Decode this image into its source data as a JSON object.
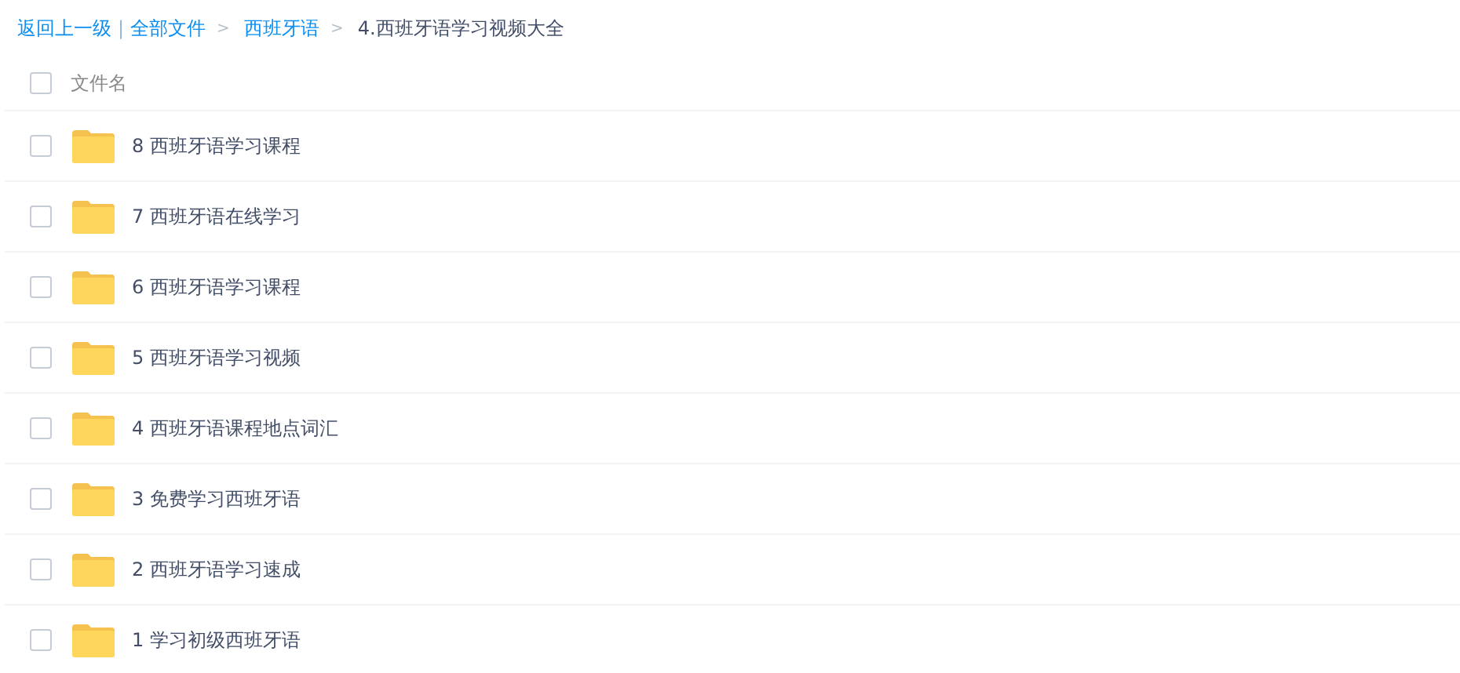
{
  "breadcrumb": {
    "back": "返回上一级",
    "separator": "|",
    "items": [
      {
        "label": "全部文件",
        "link": true
      },
      {
        "label": "西班牙语",
        "link": true
      },
      {
        "label": "4.西班牙语学习视频大全",
        "link": false
      }
    ],
    "arrow": ">"
  },
  "table": {
    "header": {
      "label": "文件名",
      "checked": false
    },
    "rows": [
      {
        "name": "8 西班牙语学习课程",
        "checked": false
      },
      {
        "name": "7 西班牙语在线学习",
        "checked": false
      },
      {
        "name": "6 西班牙语学习课程",
        "checked": false
      },
      {
        "name": "5 西班牙语学习视频",
        "checked": false
      },
      {
        "name": "4 西班牙语课程地点词汇",
        "checked": false
      },
      {
        "name": "3 免费学习西班牙语",
        "checked": false
      },
      {
        "name": "2 西班牙语学习速成",
        "checked": false
      },
      {
        "name": "1 学习初级西班牙语",
        "checked": false
      }
    ]
  }
}
